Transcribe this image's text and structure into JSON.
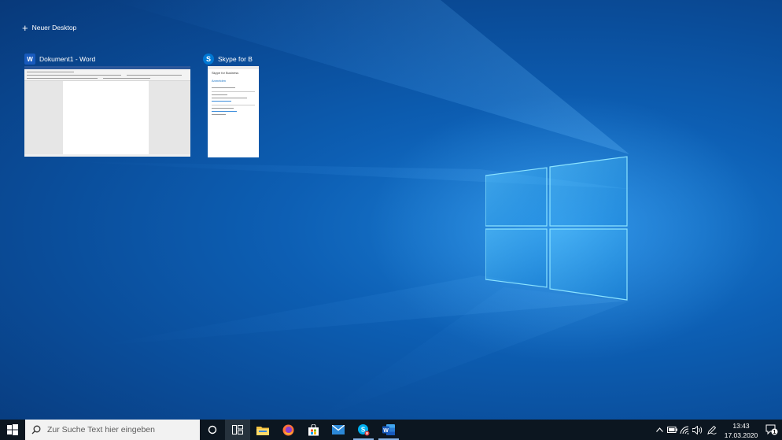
{
  "task_view": {
    "new_desktop_label": "Neuer Desktop",
    "windows": [
      {
        "title": "Dokument1 - Word",
        "icon": "word-icon"
      },
      {
        "title": "Skype for B",
        "icon": "skype-icon"
      }
    ]
  },
  "skype_preview": {
    "heading": "Skype for Business",
    "subheading": "Anmelden"
  },
  "taskbar": {
    "search_placeholder": "Zur Suche Text hier eingeben",
    "pinned": [
      "start-icon",
      "cortana-icon",
      "task-view-icon",
      "file-explorer-icon",
      "firefox-icon",
      "store-icon",
      "mail-icon",
      "skype-icon",
      "word-icon"
    ],
    "clock_time": "13:43",
    "clock_date": "17.03.2020",
    "notification_count": "1"
  },
  "colors": {
    "taskbar": "#0c1620",
    "accent": "#0078d4",
    "word": "#185abd"
  }
}
